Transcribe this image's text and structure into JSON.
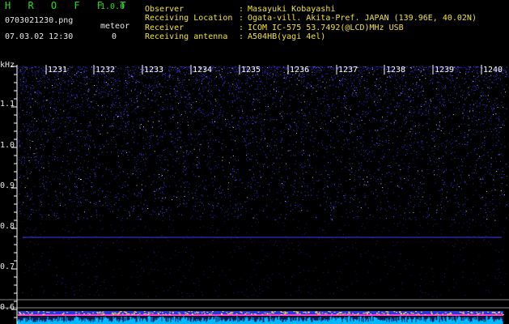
{
  "header": {
    "app_title": "H R O F F T",
    "app_version": "1.0.0",
    "file_name": "0703021230.png",
    "meteor_label": "meteor",
    "datetime": "07.03.02 12:30",
    "meteor_count": "0"
  },
  "station_info": [
    {
      "key": "Observer",
      "value": "Masayuki Kobayashi"
    },
    {
      "key": "Receiving Location",
      "value": "Ogata-vill. Akita-Pref. JAPAN (139.96E, 40.02N)"
    },
    {
      "key": "Receiver",
      "value": "ICOM IC-575 53.7492(@LCD)MHz USB"
    },
    {
      "key": "Receiving antenna",
      "value": "A504HB(yagi 4el)"
    }
  ],
  "separator": ":",
  "spectrogram": {
    "y_unit": "kHz",
    "y_ticks": [
      "1.1",
      "1.0",
      "0.9",
      "0.8",
      "0.7",
      "0.6"
    ],
    "time_ticks": [
      "1231",
      "1232",
      "1233",
      "1234",
      "1235",
      "1236",
      "1237",
      "1238",
      "1239",
      "1240"
    ],
    "colors": {
      "background": "#000000",
      "noise": "#2a2aff",
      "carrier": "#ff3fd0",
      "baseline": "#00c0ff"
    }
  }
}
